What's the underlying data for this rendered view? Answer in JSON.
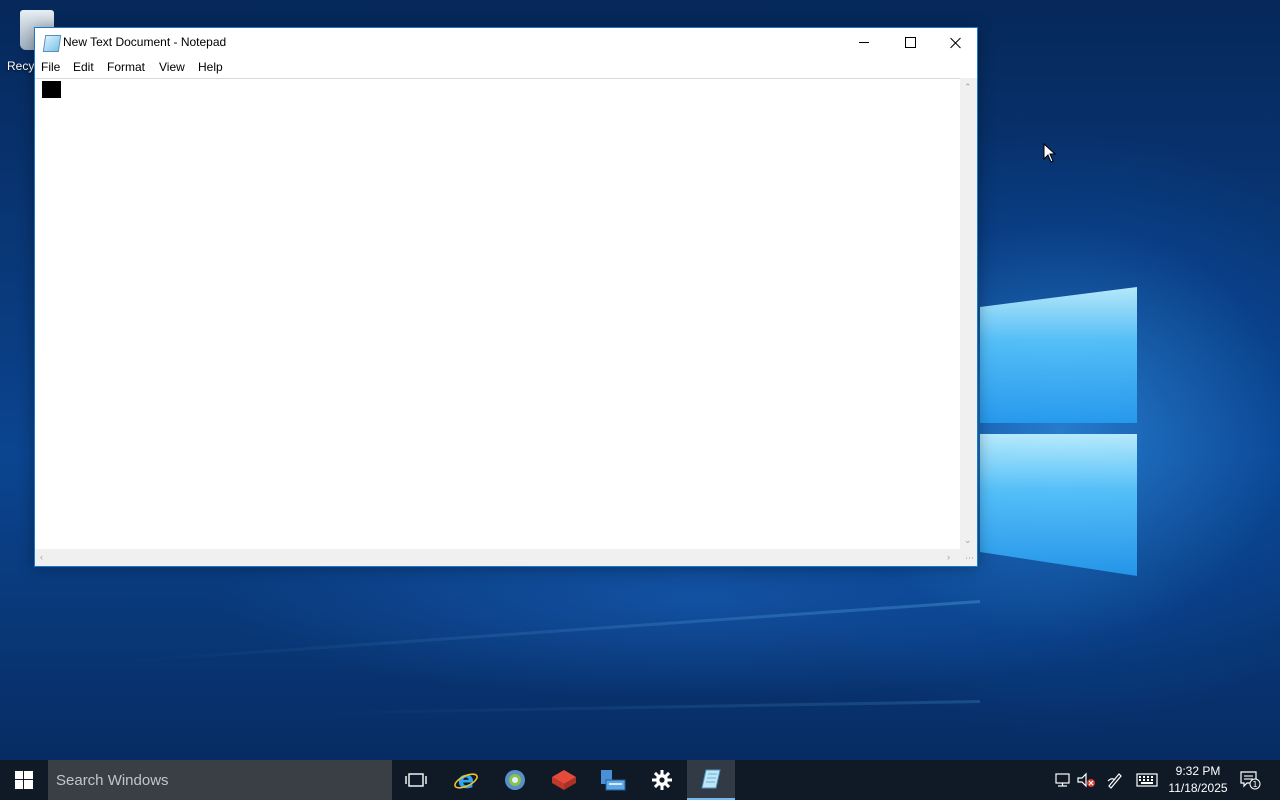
{
  "desktop": {
    "recycle_bin_label": "Recy"
  },
  "window": {
    "title": "New Text Document - Notepad",
    "menu": [
      "File",
      "Edit",
      "Format",
      "View",
      "Help"
    ],
    "content": ""
  },
  "taskbar": {
    "search_placeholder": "Search Windows",
    "pinned": [
      "task-view-icon",
      "internet-explorer-icon",
      "browser-icon",
      "app-icon",
      "file-manager-icon",
      "settings-icon",
      "notepad-icon"
    ],
    "clock_time": "9:32 PM",
    "clock_date": "11/18/2025",
    "notification_count": "1"
  },
  "colors": {
    "accent": "#1979ca",
    "taskbar": "#101a27",
    "search_box": "#3a3f46"
  }
}
